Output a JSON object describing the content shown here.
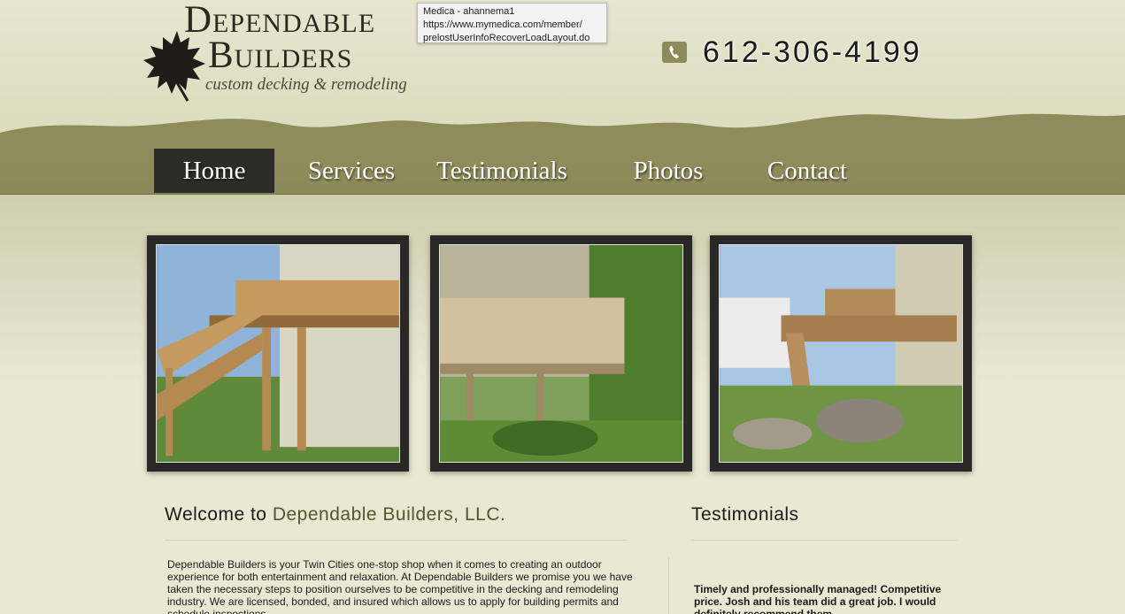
{
  "header": {
    "logo": {
      "line1": "Dependable",
      "line2": "Builders",
      "tagline": "custom decking & remodeling"
    },
    "phone": "612-306-4199",
    "tooltip": {
      "line1": "Medica - ahannema1",
      "line2": "https://www.mymedica.com/member/",
      "line3": "prelostUserInfoRecoverLoadLayout.do"
    }
  },
  "nav": {
    "items": [
      {
        "label": "Home",
        "active": true
      },
      {
        "label": "Services",
        "active": false
      },
      {
        "label": "Testimonials",
        "active": false
      },
      {
        "label": "Photos",
        "active": false
      },
      {
        "label": "Contact",
        "active": false
      }
    ]
  },
  "gallery": {
    "photos": [
      {
        "icon": "deck-photo-1"
      },
      {
        "icon": "deck-photo-2"
      },
      {
        "icon": "deck-photo-3"
      }
    ]
  },
  "welcome": {
    "title_prefix": "Welcome to ",
    "title_accent": "Dependable Builders, LLC.",
    "body": "Dependable Builders is your Twin Cities one-stop shop when it comes to creating an outdoor experience for both entertainment and relaxation.  At Dependable Builders we promise you we have taken the necessary steps to position ourselves to be competitive in the decking and remodeling industry. We are licensed, bonded, and insured which allows us to apply for building permits and schedule inspections."
  },
  "testimonials": {
    "title": "Testimonials",
    "quote": "Timely and professionally managed! Competitive price. Josh and his team did a great job. I would definitely recommend them."
  },
  "colors": {
    "olive": "#8d8b5c",
    "nav_active": "#2c2c2a",
    "accent_text": "#57552e",
    "page_bg": "#e9e8d2"
  }
}
